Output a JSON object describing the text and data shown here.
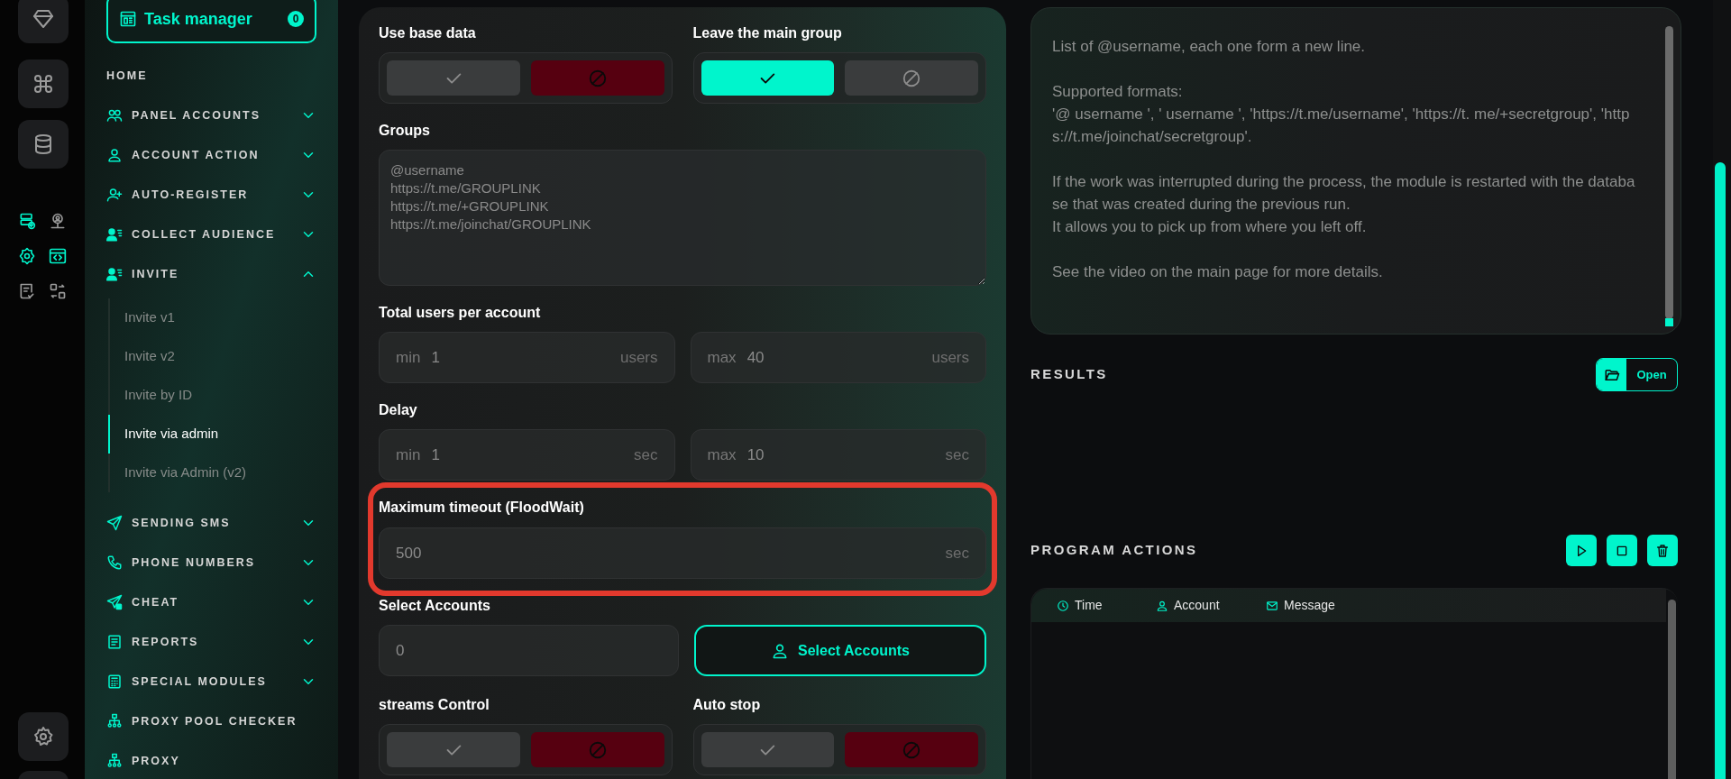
{
  "task_manager": {
    "label": "Task manager",
    "count": "0"
  },
  "sidebar": {
    "items": [
      {
        "label": "HOME",
        "kind": "link"
      },
      {
        "label": "PANEL ACCOUNTS",
        "kind": "section",
        "expanded": false
      },
      {
        "label": "ACCOUNT ACTION",
        "kind": "section",
        "expanded": false
      },
      {
        "label": "AUTO-REGISTER",
        "kind": "section",
        "expanded": false
      },
      {
        "label": "COLLECT AUDIENCE",
        "kind": "section",
        "expanded": false
      },
      {
        "label": "INVITE",
        "kind": "section",
        "expanded": true,
        "children": [
          {
            "label": "Invite v1",
            "selected": false
          },
          {
            "label": "Invite v2",
            "selected": false
          },
          {
            "label": "Invite by ID",
            "selected": false
          },
          {
            "label": "Invite via admin",
            "selected": true
          },
          {
            "label": "Invite via Admin (v2)",
            "selected": false
          }
        ]
      },
      {
        "label": "SENDING SMS",
        "kind": "section",
        "expanded": false
      },
      {
        "label": "PHONE NUMBERS",
        "kind": "section",
        "expanded": false
      },
      {
        "label": "CHEAT",
        "kind": "section",
        "expanded": false
      },
      {
        "label": "REPORTS",
        "kind": "section",
        "expanded": false
      },
      {
        "label": "SPECIAL MODULES",
        "kind": "section",
        "expanded": false
      },
      {
        "label": "PROXY POOL CHECKER",
        "kind": "link"
      },
      {
        "label": "PROXY",
        "kind": "link"
      }
    ]
  },
  "form": {
    "use_base_data": {
      "label": "Use base data",
      "on": false
    },
    "leave_main_group": {
      "label": "Leave the main group",
      "on": true
    },
    "groups": {
      "label": "Groups",
      "placeholder": "@username\nhttps://t.me/GROUPLINK\nhttps://t.me/+GROUPLINK\nhttps://t.me/joinchat/GROUPLINK"
    },
    "total_users": {
      "label": "Total users per account",
      "min": {
        "prefix": "min",
        "value": "1",
        "unit": "users"
      },
      "max": {
        "prefix": "max",
        "value": "40",
        "unit": "users"
      }
    },
    "delay": {
      "label": "Delay",
      "min": {
        "prefix": "min",
        "value": "1",
        "unit": "sec"
      },
      "max": {
        "prefix": "max",
        "value": "10",
        "unit": "sec"
      }
    },
    "max_timeout": {
      "label": "Maximum timeout (FloodWait)",
      "value": "500",
      "unit": "sec",
      "highlighted": true
    },
    "select_accounts": {
      "label": "Select Accounts",
      "value": "0",
      "button": "Select Accounts"
    },
    "streams_control": {
      "label": "streams Control",
      "on": false
    },
    "auto_stop": {
      "label": "Auto stop",
      "on": false
    }
  },
  "help": {
    "placeholder": "List of @username, each one form a new line.\n\nSupported formats:\n'@ username ', ' username ', 'https://t.me/username', 'https://t. me/+secretgroup', 'https://t.me/joinchat/secretgroup'.\n\nIf the work was interrupted during the process, the module is restarted with the database that was created during the previous run.\nIt allows you to pick up from where you left off.\n\nSee the video on the main page for more details."
  },
  "results": {
    "title": "RESULTS",
    "open_button": "Open"
  },
  "program_actions": {
    "title": "PROGRAM ACTIONS",
    "columns": [
      "Time",
      "Account",
      "Message"
    ]
  }
}
